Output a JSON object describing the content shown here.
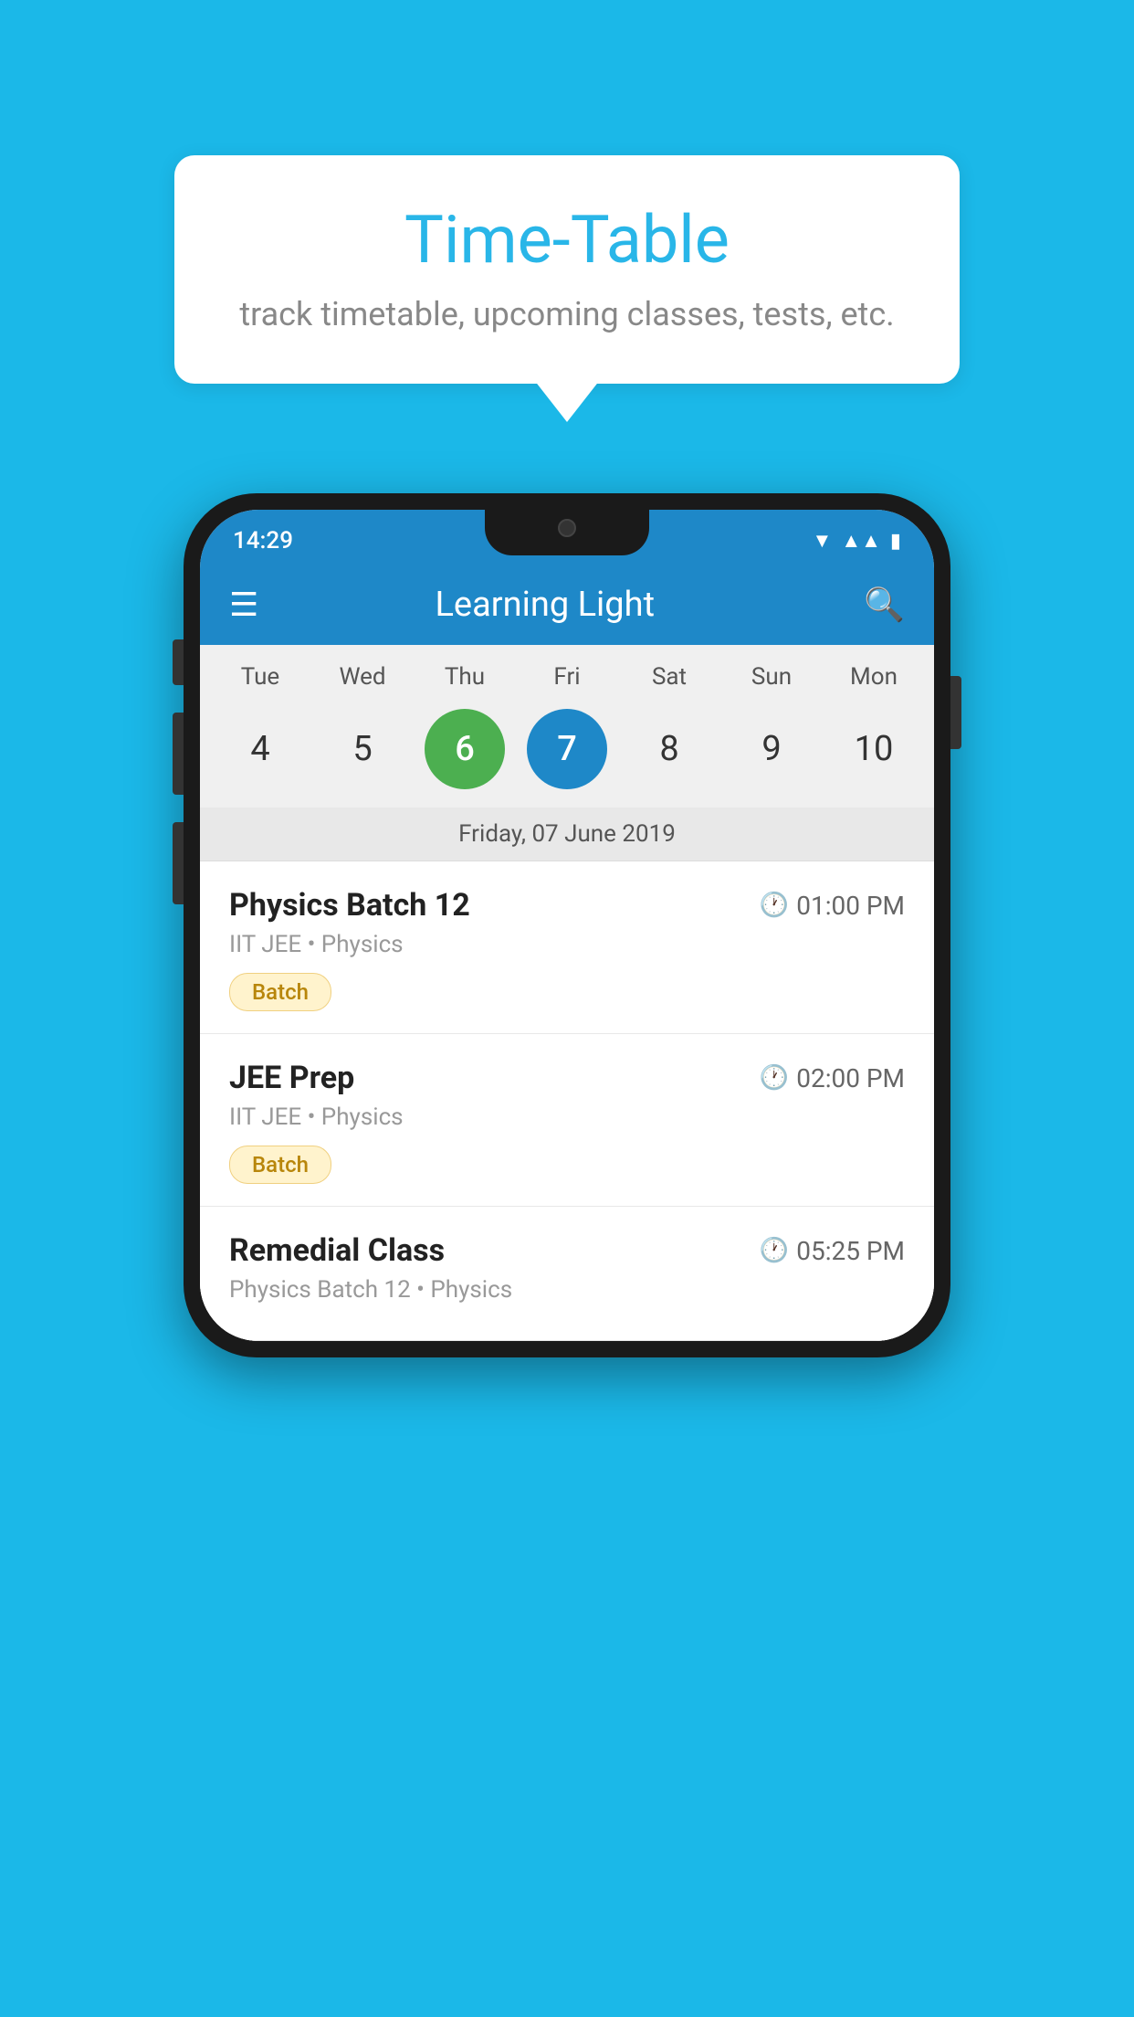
{
  "background": {
    "color": "#1bb8e8"
  },
  "speech_bubble": {
    "title": "Time-Table",
    "subtitle": "track timetable, upcoming classes, tests, etc."
  },
  "phone": {
    "status_bar": {
      "time": "14:29"
    },
    "app_bar": {
      "title": "Learning Light"
    },
    "calendar": {
      "days": [
        "Tue",
        "Wed",
        "Thu",
        "Fri",
        "Sat",
        "Sun",
        "Mon"
      ],
      "dates": [
        4,
        5,
        6,
        7,
        8,
        9,
        10
      ],
      "today_index": 2,
      "selected_index": 3,
      "selected_label": "Friday, 07 June 2019"
    },
    "schedule": [
      {
        "title": "Physics Batch 12",
        "time": "01:00 PM",
        "subtitle": "IIT JEE • Physics",
        "tag": "Batch"
      },
      {
        "title": "JEE Prep",
        "time": "02:00 PM",
        "subtitle": "IIT JEE • Physics",
        "tag": "Batch"
      },
      {
        "title": "Remedial Class",
        "time": "05:25 PM",
        "subtitle": "Physics Batch 12 • Physics",
        "tag": ""
      }
    ]
  }
}
